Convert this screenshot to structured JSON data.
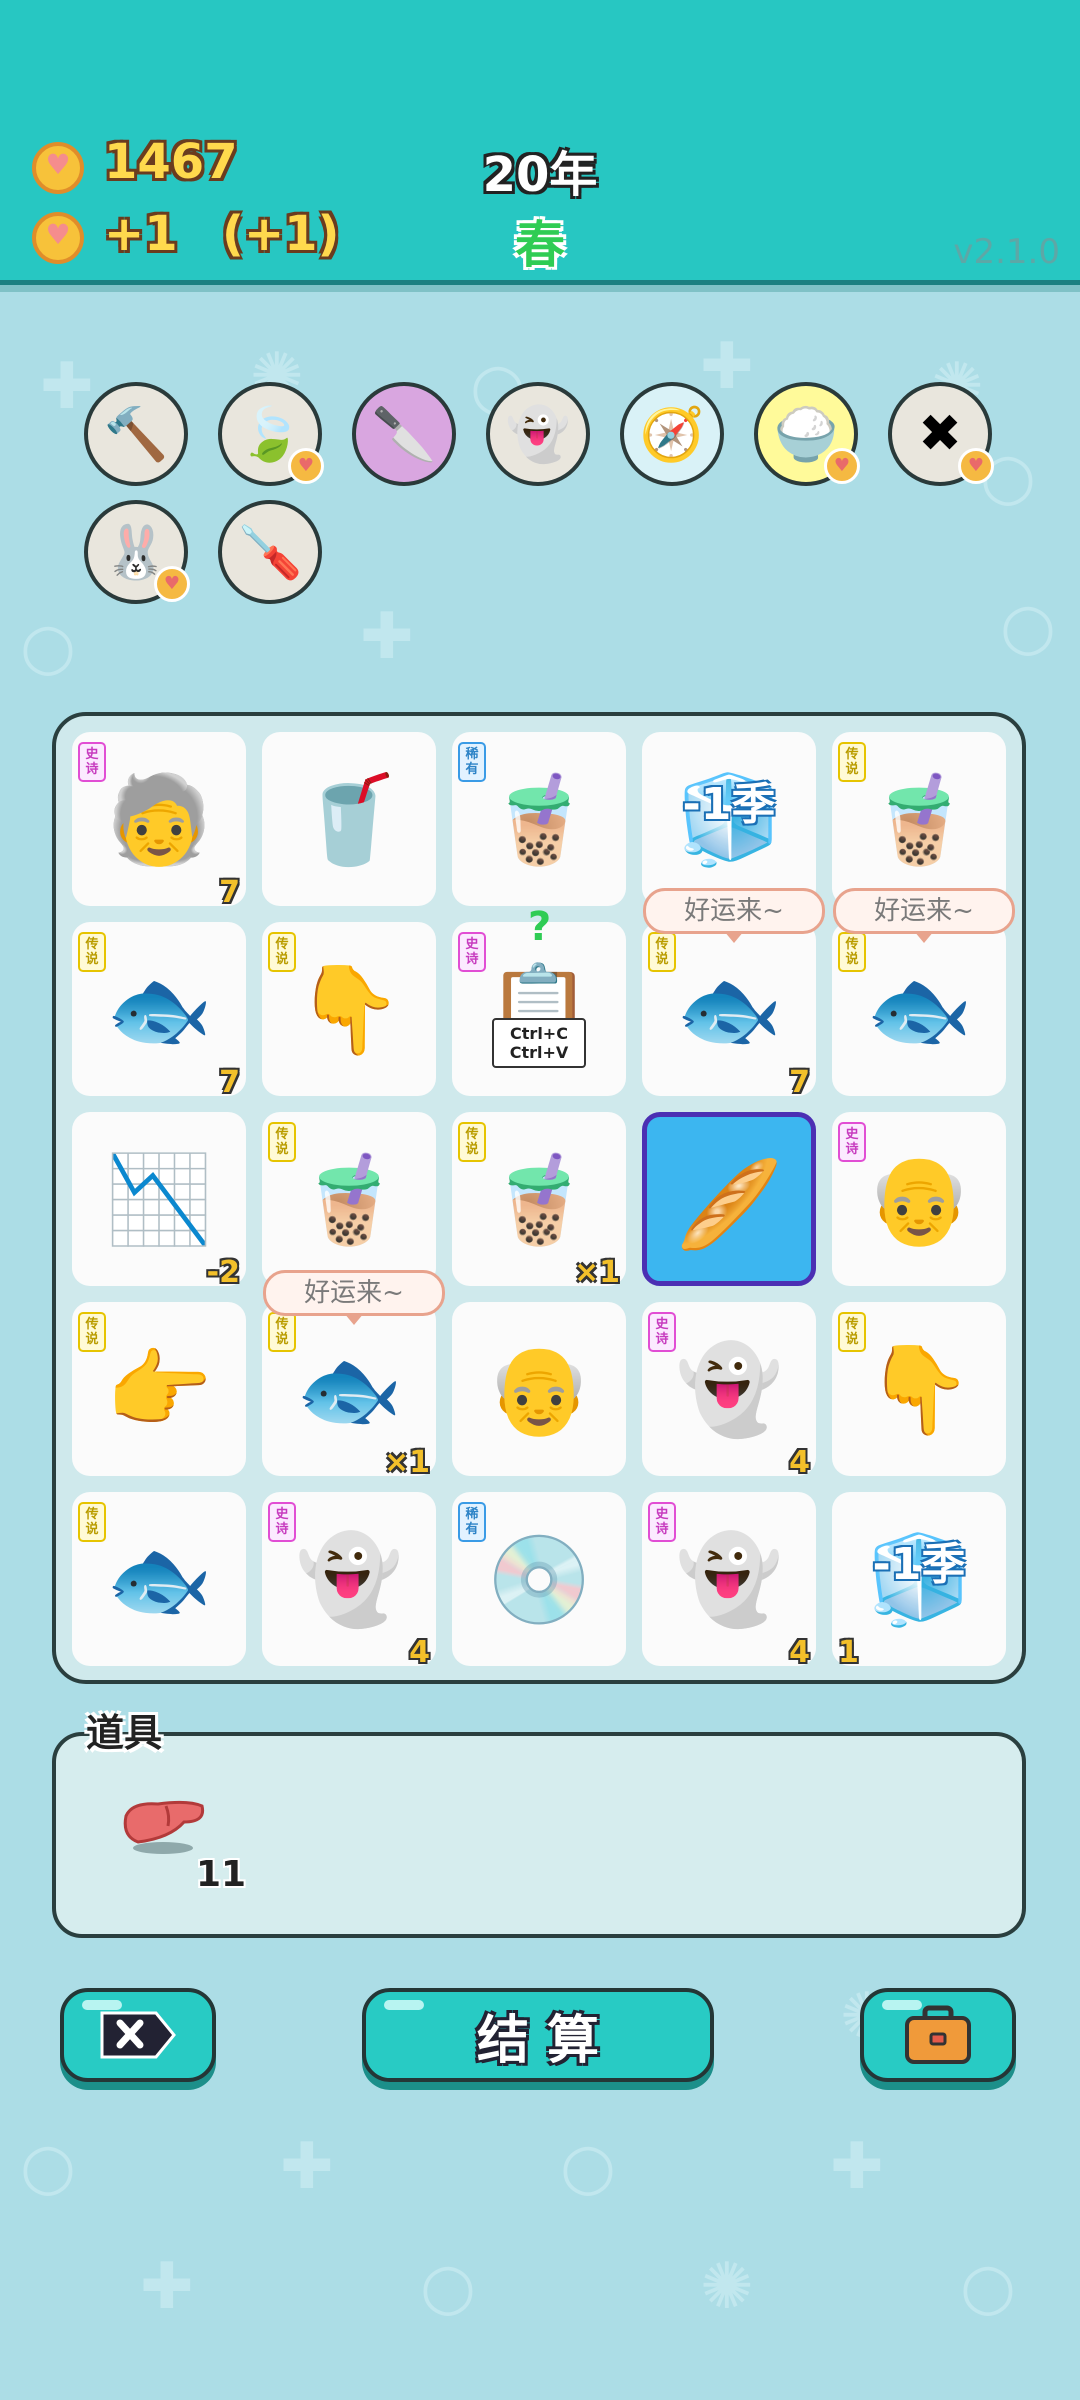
{
  "header": {
    "coins": "1467",
    "income": "+1",
    "income_bonus": "(+1)",
    "year": "20年",
    "season": "春",
    "version": "v2.1.0"
  },
  "tools": [
    {
      "name": "hammer-icon",
      "glyph": "🔨"
    },
    {
      "name": "leaf-icon",
      "glyph": "🍃"
    },
    {
      "name": "cleaver-icon",
      "glyph": "🔪"
    },
    {
      "name": "ghost-icon",
      "glyph": "👻"
    },
    {
      "name": "compass-icon",
      "glyph": "🧭"
    },
    {
      "name": "rice-bowl-icon",
      "glyph": "🍚"
    },
    {
      "name": "delete-tag-icon",
      "glyph": "✖"
    },
    {
      "name": "rabbit-icon",
      "glyph": "🐰"
    },
    {
      "name": "screwdriver-icon",
      "glyph": "🪛"
    }
  ],
  "rarity_labels": {
    "epic": "史诗",
    "legend": "传说",
    "rare": "稀有"
  },
  "board": {
    "cells": [
      {
        "icon": "🧓",
        "icon_name": "bearded-man-icon",
        "tag": "史诗",
        "tagType": "epic",
        "num": "7"
      },
      {
        "icon": "🥤",
        "icon_name": "small-bubble-tea-icon",
        "tag": "",
        "tagType": "",
        "num": ""
      },
      {
        "icon": "🧋",
        "icon_name": "bubble-tea-icon",
        "tag": "稀有",
        "tagType": "rare",
        "num": ""
      },
      {
        "icon": "🧊",
        "icon_name": "minus-one-season-icon",
        "tag": "",
        "tagType": "",
        "num": "",
        "overlay": "-1季"
      },
      {
        "icon": "🧋",
        "icon_name": "large-bubble-tea-icon",
        "tag": "传说",
        "tagType": "legend",
        "num": ""
      },
      {
        "icon": "🐟",
        "icon_name": "koi-fish-icon",
        "tag": "传说",
        "tagType": "legend",
        "num": "7"
      },
      {
        "icon": "👇",
        "icon_name": "pointing-hand-down-icon",
        "tag": "传说",
        "tagType": "legend",
        "num": ""
      },
      {
        "icon": "📋",
        "icon_name": "copy-paste-icon",
        "tag": "史诗",
        "tagType": "epic",
        "num": "",
        "overlay": "Ctrl+C Ctrl+V"
      },
      {
        "icon": "🐟",
        "icon_name": "koi-fish-icon",
        "tag": "传说",
        "tagType": "legend",
        "num": "7"
      },
      {
        "icon": "🐟",
        "icon_name": "koi-fish-icon",
        "tag": "传说",
        "tagType": "legend",
        "num": ""
      },
      {
        "icon": "📉",
        "icon_name": "downtrend-chart-icon",
        "tag": "",
        "tagType": "",
        "num": "-2"
      },
      {
        "icon": "🧋",
        "icon_name": "large-bubble-tea-icon",
        "tag": "传说",
        "tagType": "legend",
        "num": ""
      },
      {
        "icon": "🧋",
        "icon_name": "large-bubble-tea-icon",
        "tag": "传说",
        "tagType": "legend",
        "num": "×1"
      },
      {
        "icon": "🥖",
        "icon_name": "rolling-pin-icon",
        "tag": "",
        "tagType": "",
        "num": ""
      },
      {
        "icon": "👴",
        "icon_name": "old-man-icon",
        "tag": "史诗",
        "tagType": "epic",
        "num": ""
      },
      {
        "icon": "👉",
        "icon_name": "pointing-hand-right-icon",
        "tag": "传说",
        "tagType": "legend",
        "num": ""
      },
      {
        "icon": "🐟",
        "icon_name": "koi-fish-icon",
        "tag": "传说",
        "tagType": "legend",
        "num": "×1"
      },
      {
        "icon": "👴",
        "icon_name": "old-man-icon",
        "tag": "",
        "tagType": "",
        "num": ""
      },
      {
        "icon": "👻",
        "icon_name": "ghost-icon",
        "tag": "史诗",
        "tagType": "epic",
        "num": "4"
      },
      {
        "icon": "👇",
        "icon_name": "pointing-hand-down-icon",
        "tag": "传说",
        "tagType": "legend",
        "num": ""
      },
      {
        "icon": "🐟",
        "icon_name": "koi-fish-icon",
        "tag": "传说",
        "tagType": "legend",
        "num": ""
      },
      {
        "icon": "👻",
        "icon_name": "ghost-icon",
        "tag": "史诗",
        "tagType": "epic",
        "num": "4"
      },
      {
        "icon": "💿",
        "icon_name": "ghost-disc-icon",
        "tag": "稀有",
        "tagType": "rare",
        "num": ""
      },
      {
        "icon": "👻",
        "icon_name": "ghost-icon",
        "tag": "史诗",
        "tagType": "epic",
        "num": "4"
      },
      {
        "icon": "🧊",
        "icon_name": "minus-one-season-icon",
        "tag": "",
        "tagType": "",
        "num": "1",
        "numLeft": true,
        "overlay": "-1季"
      }
    ],
    "bubbles": [
      "好运来~",
      "好运来~",
      "好运来~"
    ],
    "question_mark": "?"
  },
  "items": {
    "title": "道具",
    "list": [
      {
        "icon": "liver-icon",
        "count": "11"
      }
    ]
  },
  "buttons": {
    "remove_icon": "delete-tag-icon",
    "settle_label": "结 算",
    "bag_icon": "briefcase-icon"
  }
}
